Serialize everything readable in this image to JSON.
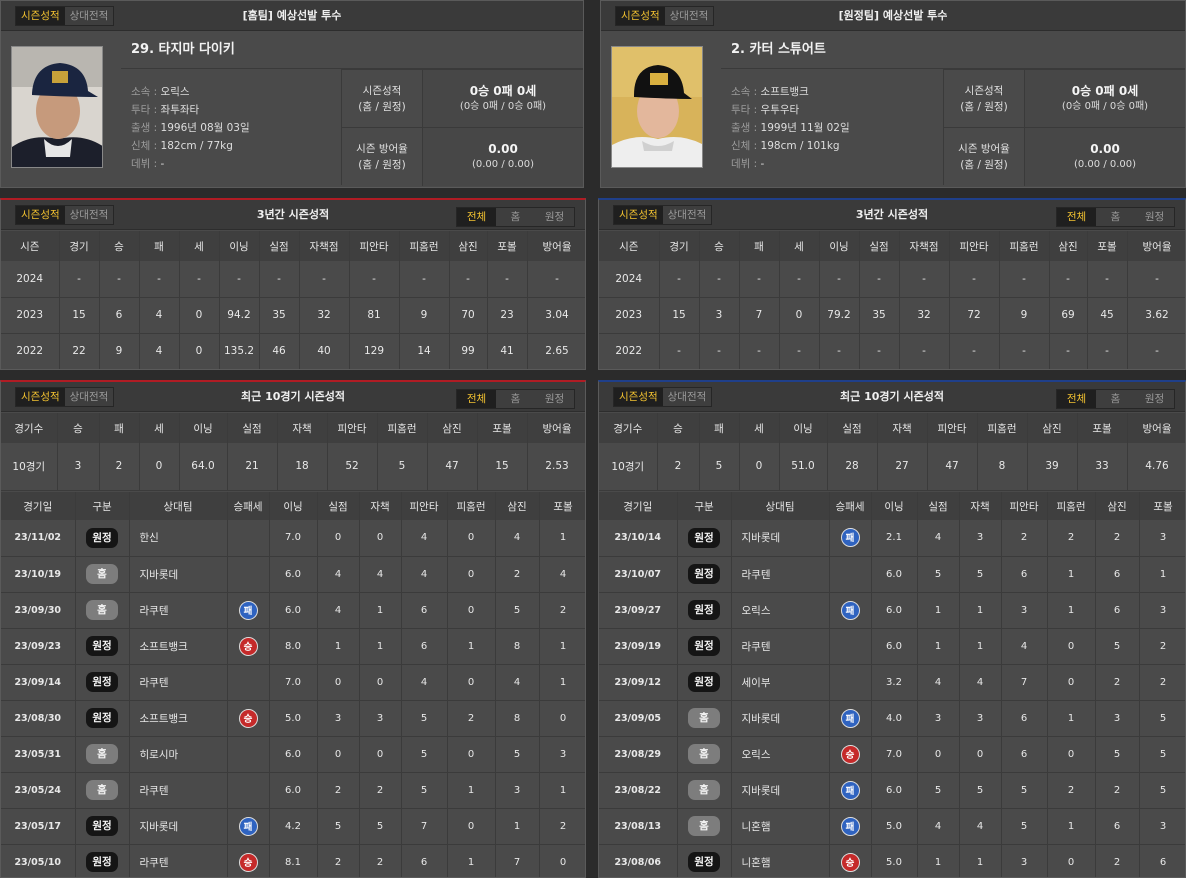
{
  "tabs": {
    "season": "시즌성적",
    "versus": "상대전적"
  },
  "filters": {
    "all": "전체",
    "home": "홈",
    "away": "원정"
  },
  "colors": {
    "accent": "#f2c230",
    "home_line": "#b01c24",
    "away_line": "#1f3f8a",
    "loss": "#2f63c0",
    "win": "#c52a2a"
  },
  "labels": {
    "season_stat": "시즌성적",
    "season_stat_sub": "(홈 / 원정)",
    "season_era": "시즌 방어율",
    "season_era_sub": "(홈 / 원정)"
  },
  "home": {
    "header": "[홈팀] 예상선발 투수",
    "name": "29. 타지마 다이키",
    "info": [
      {
        "k": "소속",
        "v": "오릭스"
      },
      {
        "k": "투타",
        "v": "좌투좌타"
      },
      {
        "k": "출생",
        "v": "1996년 08월 03일"
      },
      {
        "k": "신체",
        "v": "182cm / 77kg"
      },
      {
        "k": "데뷔",
        "v": "-"
      }
    ],
    "season_record": "0승 0패 0세",
    "season_record_sub": "(0승 0패 / 0승 0패)",
    "season_era": "0.00",
    "season_era_sub": "(0.00 / 0.00)",
    "three_title": "3년간 시즌성적",
    "three_headers": [
      "시즌",
      "경기",
      "승",
      "패",
      "세",
      "이닝",
      "실점",
      "자책점",
      "피안타",
      "피홈런",
      "삼진",
      "포볼",
      "방어율"
    ],
    "three_rows": [
      [
        "2024",
        "-",
        "-",
        "-",
        "-",
        "-",
        "-",
        "-",
        "-",
        "-",
        "-",
        "-",
        "-"
      ],
      [
        "2023",
        "15",
        "6",
        "4",
        "0",
        "94.2",
        "35",
        "32",
        "81",
        "9",
        "70",
        "23",
        "3.04"
      ],
      [
        "2022",
        "22",
        "9",
        "4",
        "0",
        "135.2",
        "46",
        "40",
        "129",
        "14",
        "99",
        "41",
        "2.65"
      ]
    ],
    "ten_title": "최근 10경기 시즌성적",
    "ten_headers": [
      "경기수",
      "승",
      "패",
      "세",
      "이닝",
      "실점",
      "자책",
      "피안타",
      "피홈런",
      "삼진",
      "포볼",
      "방어율"
    ],
    "ten_row": [
      "10경기",
      "3",
      "2",
      "0",
      "64.0",
      "21",
      "18",
      "52",
      "5",
      "47",
      "15",
      "2.53"
    ],
    "game_headers": [
      "경기일",
      "구분",
      "상대팀",
      "승패세",
      "이닝",
      "실점",
      "자책",
      "피안타",
      "피홈런",
      "삼진",
      "포볼"
    ],
    "games": [
      {
        "date": "23/11/02",
        "div": "원정",
        "opp": "한신",
        "res": "",
        "ip": "7.0",
        "r": "0",
        "er": "0",
        "h": "4",
        "hr": "0",
        "so": "4",
        "bb": "1"
      },
      {
        "date": "23/10/19",
        "div": "홈",
        "opp": "지바롯데",
        "res": "",
        "ip": "6.0",
        "r": "4",
        "er": "4",
        "h": "4",
        "hr": "0",
        "so": "2",
        "bb": "4"
      },
      {
        "date": "23/09/30",
        "div": "홈",
        "opp": "라쿠텐",
        "res": "패",
        "ip": "6.0",
        "r": "4",
        "er": "1",
        "h": "6",
        "hr": "0",
        "so": "5",
        "bb": "2"
      },
      {
        "date": "23/09/23",
        "div": "원정",
        "opp": "소프트뱅크",
        "res": "승",
        "ip": "8.0",
        "r": "1",
        "er": "1",
        "h": "6",
        "hr": "1",
        "so": "8",
        "bb": "1"
      },
      {
        "date": "23/09/14",
        "div": "원정",
        "opp": "라쿠텐",
        "res": "",
        "ip": "7.0",
        "r": "0",
        "er": "0",
        "h": "4",
        "hr": "0",
        "so": "4",
        "bb": "1"
      },
      {
        "date": "23/08/30",
        "div": "원정",
        "opp": "소프트뱅크",
        "res": "승",
        "ip": "5.0",
        "r": "3",
        "er": "3",
        "h": "5",
        "hr": "2",
        "so": "8",
        "bb": "0"
      },
      {
        "date": "23/05/31",
        "div": "홈",
        "opp": "히로시마",
        "res": "",
        "ip": "6.0",
        "r": "0",
        "er": "0",
        "h": "5",
        "hr": "0",
        "so": "5",
        "bb": "3"
      },
      {
        "date": "23/05/24",
        "div": "홈",
        "opp": "라쿠텐",
        "res": "",
        "ip": "6.0",
        "r": "2",
        "er": "2",
        "h": "5",
        "hr": "1",
        "so": "3",
        "bb": "1"
      },
      {
        "date": "23/05/17",
        "div": "원정",
        "opp": "지바롯데",
        "res": "패",
        "ip": "4.2",
        "r": "5",
        "er": "5",
        "h": "7",
        "hr": "0",
        "so": "1",
        "bb": "2"
      },
      {
        "date": "23/05/10",
        "div": "원정",
        "opp": "라쿠텐",
        "res": "승",
        "ip": "8.1",
        "r": "2",
        "er": "2",
        "h": "6",
        "hr": "1",
        "so": "7",
        "bb": "0"
      }
    ]
  },
  "away": {
    "header": "[원정팀] 예상선발 투수",
    "name": "2. 카터 스튜어트",
    "info": [
      {
        "k": "소속",
        "v": "소프트뱅크"
      },
      {
        "k": "투타",
        "v": "우투우타"
      },
      {
        "k": "출생",
        "v": "1999년 11월 02일"
      },
      {
        "k": "신체",
        "v": "198cm / 101kg"
      },
      {
        "k": "데뷔",
        "v": "-"
      }
    ],
    "season_record": "0승 0패 0세",
    "season_record_sub": "(0승 0패 / 0승 0패)",
    "season_era": "0.00",
    "season_era_sub": "(0.00 / 0.00)",
    "three_title": "3년간 시즌성적",
    "three_headers": [
      "시즌",
      "경기",
      "승",
      "패",
      "세",
      "이닝",
      "실점",
      "자책점",
      "피안타",
      "피홈런",
      "삼진",
      "포볼",
      "방어율"
    ],
    "three_rows": [
      [
        "2024",
        "-",
        "-",
        "-",
        "-",
        "-",
        "-",
        "-",
        "-",
        "-",
        "-",
        "-",
        "-"
      ],
      [
        "2023",
        "15",
        "3",
        "7",
        "0",
        "79.2",
        "35",
        "32",
        "72",
        "9",
        "69",
        "45",
        "3.62"
      ],
      [
        "2022",
        "-",
        "-",
        "-",
        "-",
        "-",
        "-",
        "-",
        "-",
        "-",
        "-",
        "-",
        "-"
      ]
    ],
    "ten_title": "최근 10경기 시즌성적",
    "ten_headers": [
      "경기수",
      "승",
      "패",
      "세",
      "이닝",
      "실점",
      "자책",
      "피안타",
      "피홈런",
      "삼진",
      "포볼",
      "방어율"
    ],
    "ten_row": [
      "10경기",
      "2",
      "5",
      "0",
      "51.0",
      "28",
      "27",
      "47",
      "8",
      "39",
      "33",
      "4.76"
    ],
    "game_headers": [
      "경기일",
      "구분",
      "상대팀",
      "승패세",
      "이닝",
      "실점",
      "자책",
      "피안타",
      "피홈런",
      "삼진",
      "포볼"
    ],
    "games": [
      {
        "date": "23/10/14",
        "div": "원정",
        "opp": "지바롯데",
        "res": "패",
        "ip": "2.1",
        "r": "4",
        "er": "3",
        "h": "2",
        "hr": "2",
        "so": "2",
        "bb": "3"
      },
      {
        "date": "23/10/07",
        "div": "원정",
        "opp": "라쿠텐",
        "res": "",
        "ip": "6.0",
        "r": "5",
        "er": "5",
        "h": "6",
        "hr": "1",
        "so": "6",
        "bb": "1"
      },
      {
        "date": "23/09/27",
        "div": "원정",
        "opp": "오릭스",
        "res": "패",
        "ip": "6.0",
        "r": "1",
        "er": "1",
        "h": "3",
        "hr": "1",
        "so": "6",
        "bb": "3"
      },
      {
        "date": "23/09/19",
        "div": "원정",
        "opp": "라쿠텐",
        "res": "",
        "ip": "6.0",
        "r": "1",
        "er": "1",
        "h": "4",
        "hr": "0",
        "so": "5",
        "bb": "2"
      },
      {
        "date": "23/09/12",
        "div": "원정",
        "opp": "세이부",
        "res": "",
        "ip": "3.2",
        "r": "4",
        "er": "4",
        "h": "7",
        "hr": "0",
        "so": "2",
        "bb": "2"
      },
      {
        "date": "23/09/05",
        "div": "홈",
        "opp": "지바롯데",
        "res": "패",
        "ip": "4.0",
        "r": "3",
        "er": "3",
        "h": "6",
        "hr": "1",
        "so": "3",
        "bb": "5"
      },
      {
        "date": "23/08/29",
        "div": "홈",
        "opp": "오릭스",
        "res": "승",
        "ip": "7.0",
        "r": "0",
        "er": "0",
        "h": "6",
        "hr": "0",
        "so": "5",
        "bb": "5"
      },
      {
        "date": "23/08/22",
        "div": "홈",
        "opp": "지바롯데",
        "res": "패",
        "ip": "6.0",
        "r": "5",
        "er": "5",
        "h": "5",
        "hr": "2",
        "so": "2",
        "bb": "5"
      },
      {
        "date": "23/08/13",
        "div": "홈",
        "opp": "니혼햄",
        "res": "패",
        "ip": "5.0",
        "r": "4",
        "er": "4",
        "h": "5",
        "hr": "1",
        "so": "6",
        "bb": "3"
      },
      {
        "date": "23/08/06",
        "div": "원정",
        "opp": "니혼햄",
        "res": "승",
        "ip": "5.0",
        "r": "1",
        "er": "1",
        "h": "3",
        "hr": "0",
        "so": "2",
        "bb": "6"
      }
    ]
  }
}
